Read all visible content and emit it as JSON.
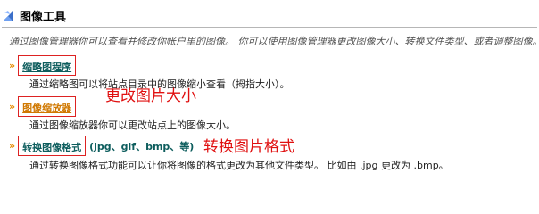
{
  "header": {
    "title": "图像工具",
    "icon": "tools-icon"
  },
  "intro": "通过图像管理器你可以查看并修改你帐户里的图像。 你可以使用图像管理器更改图像大小、转换文件类型、或者调整图像。",
  "sections": [
    {
      "bullet": "»",
      "link": "缩略图程序",
      "suffix": "",
      "description": "通过缩略图可以将站点目录中的图像缩小查看（拇指大小）。",
      "annotation": ""
    },
    {
      "bullet": "»",
      "link": "图像缩放器",
      "suffix": "",
      "description": "通过图像缩放器你可以更改站点上的图像大小。",
      "annotation": "更改图片大小"
    },
    {
      "bullet": "»",
      "link": "转换图像格式",
      "suffix": "(jpg、gif、bmp、等)",
      "description": "通过转换图像格式功能可以让你将图像的格式更改为其他文件类型。 比如由 .jpg 更改为 .bmp。",
      "annotation": "转换图片格式"
    }
  ],
  "colors": {
    "link": "#0d5d5d",
    "link_active": "#d07800",
    "bullet": "#e58a00",
    "annotation": "#e01010",
    "highlight_box": "#dd2222"
  }
}
